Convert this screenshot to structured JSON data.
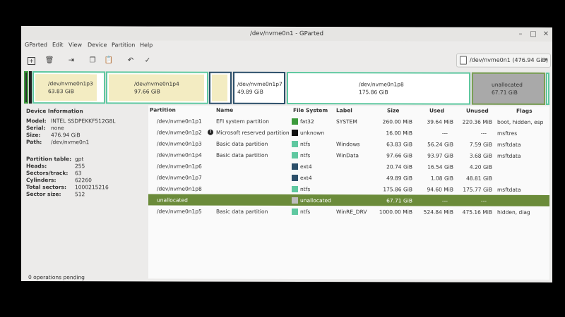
{
  "window": {
    "title": "/dev/nvme0n1 - GParted"
  },
  "menu": [
    "GParted",
    "Edit",
    "View",
    "Device",
    "Partition",
    "Help"
  ],
  "device_selector": {
    "value": "/dev/nvme0n1  (476.94 GiB)"
  },
  "map": [
    {
      "name": "/dev/nvme0n1p3",
      "size": "63.83 GiB"
    },
    {
      "name": "/dev/nvme0n1p4",
      "size": "97.66 GiB"
    },
    {
      "name": "/dev/nvme0n1p7",
      "size": "49.89 GiB"
    },
    {
      "name": "/dev/nvme0n1p8",
      "size": "175.86 GiB"
    },
    {
      "name": "unallocated",
      "size": "67.71 GiB"
    }
  ],
  "device_info": {
    "heading": "Device Information",
    "rows": [
      {
        "label": "Model:",
        "value": "INTEL SSDPEKKF512G8L"
      },
      {
        "label": "Serial:",
        "value": "none"
      },
      {
        "label": "Size:",
        "value": "476.94 GiB"
      },
      {
        "label": "Path:",
        "value": "/dev/nvme0n1"
      }
    ],
    "rows2": [
      {
        "label": "Partition table:",
        "value": "gpt"
      },
      {
        "label": "Heads:",
        "value": "255"
      },
      {
        "label": "Sectors/track:",
        "value": "63"
      },
      {
        "label": "Cylinders:",
        "value": "62260"
      },
      {
        "label": "Total sectors:",
        "value": "1000215216"
      },
      {
        "label": "Sector size:",
        "value": "512"
      }
    ]
  },
  "table": {
    "headers": [
      "Partition",
      "Name",
      "File System",
      "Label",
      "Size",
      "Used",
      "Unused",
      "Flags"
    ],
    "rows": [
      {
        "partition": "/dev/nvme0n1p1",
        "name": "EFI system partition",
        "fs": "fat32",
        "label": "SYSTEM",
        "size": "260.00 MiB",
        "used": "39.64 MiB",
        "unused": "220.36 MiB",
        "flags": "boot, hidden, esp"
      },
      {
        "partition": "/dev/nvme0n1p2",
        "name": "Microsoft reserved partition",
        "fs": "unknown",
        "label": "",
        "size": "16.00 MiB",
        "used": "---",
        "unused": "---",
        "flags": "msftres"
      },
      {
        "partition": "/dev/nvme0n1p3",
        "name": "Basic data partition",
        "fs": "ntfs",
        "label": "Windows",
        "size": "63.83 GiB",
        "used": "56.24 GiB",
        "unused": "7.59 GiB",
        "flags": "msftdata"
      },
      {
        "partition": "/dev/nvme0n1p4",
        "name": "Basic data partition",
        "fs": "ntfs",
        "label": "WinData",
        "size": "97.66 GiB",
        "used": "93.97 GiB",
        "unused": "3.68 GiB",
        "flags": "msftdata"
      },
      {
        "partition": "/dev/nvme0n1p6",
        "name": "",
        "fs": "ext4",
        "label": "",
        "size": "20.74 GiB",
        "used": "16.54 GiB",
        "unused": "4.20 GiB",
        "flags": ""
      },
      {
        "partition": "/dev/nvme0n1p7",
        "name": "",
        "fs": "ext4",
        "label": "",
        "size": "49.89 GiB",
        "used": "1.08 GiB",
        "unused": "48.81 GiB",
        "flags": ""
      },
      {
        "partition": "/dev/nvme0n1p8",
        "name": "",
        "fs": "ntfs",
        "label": "",
        "size": "175.86 GiB",
        "used": "94.60 MiB",
        "unused": "175.77 GiB",
        "flags": "msftdata"
      },
      {
        "partition": "unallocated",
        "name": "",
        "fs": "unallocated",
        "label": "",
        "size": "67.71 GiB",
        "used": "---",
        "unused": "---",
        "flags": ""
      },
      {
        "partition": "/dev/nvme0n1p5",
        "name": "Basic data partition",
        "fs": "ntfs",
        "label": "WinRE_DRV",
        "size": "1000.00 MiB",
        "used": "524.84 MiB",
        "unused": "475.16 MiB",
        "flags": "hidden, diag"
      }
    ]
  },
  "status": "0 operations pending",
  "colors": {
    "fat32": "#3c9a3c",
    "ntfs": "#5fc8a0",
    "ext4": "#2c4f6a",
    "unknown": "#111111",
    "unallocated": "#bdbdbd",
    "selected_row": "#6b8b3a"
  }
}
